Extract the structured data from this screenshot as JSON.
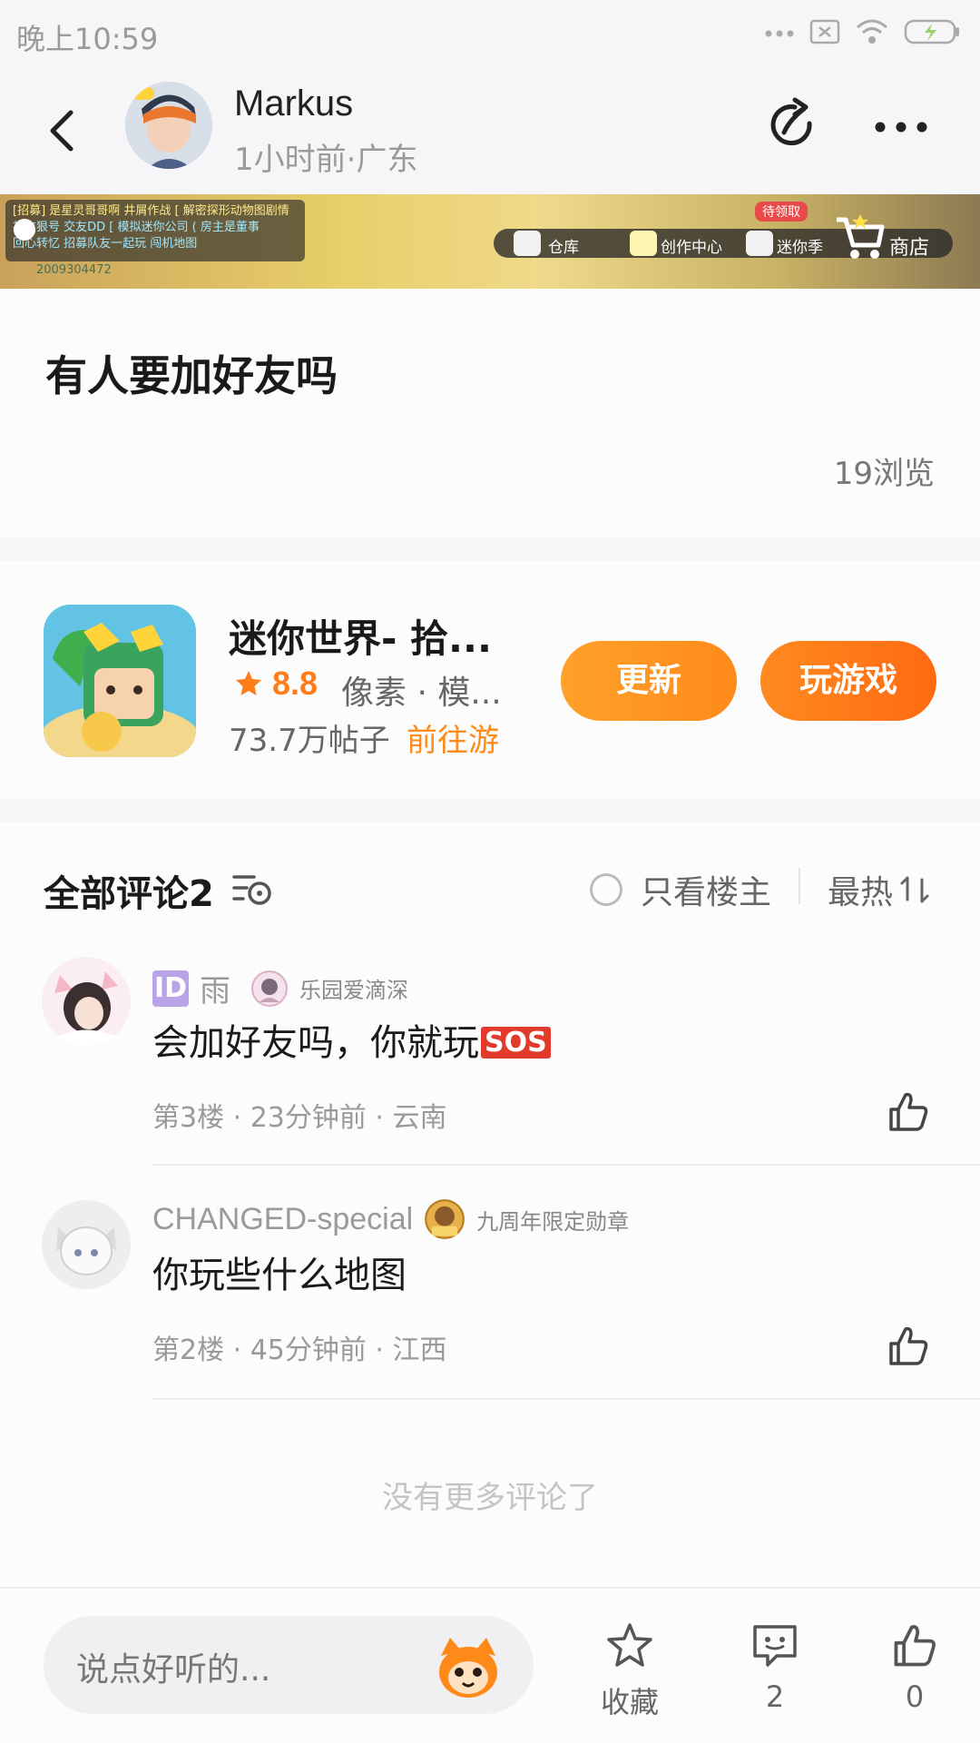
{
  "status": {
    "time": "晚上10:59"
  },
  "header": {
    "author": "Markus",
    "meta": "1小时前·广东"
  },
  "banner": {
    "chat_line1": "[招募] 是星灵哥哥啊  井屑作战 [  解密探形动物图剧情",
    "chat_line2": "  补衣狠号 交友DD [  模拟迷你公司 ( 房主是董事",
    "chat_line3": "  回心转忆 招募队友一起玩 闯机地图",
    "player_id": "2009304472",
    "toolbar": [
      "仓库",
      "创作中心",
      "迷你季",
      "商店"
    ],
    "pending": "待领取"
  },
  "post": {
    "title": "有人要加好友吗",
    "views": "19浏览"
  },
  "game": {
    "name": "迷你世界- 拾...",
    "rating": "8.8",
    "tags": "像素 · 模...",
    "posts": "73.7万帖子",
    "goto": "前往游",
    "update_label": "更新",
    "play_label": "玩游戏",
    "accent": "#ff8a1a"
  },
  "comments": {
    "title": "全部评论2",
    "only_owner": "只看楼主",
    "sort": "最热",
    "items": [
      {
        "name": "雨",
        "badge": "乐园爱滴深",
        "text": "会加好友吗，你就玩",
        "emoji": "SOS",
        "meta": "第3楼 · 23分钟前 · 云南"
      },
      {
        "name": "CHANGED-special",
        "badge": "九周年限定勋章",
        "text": "你玩些什么地图",
        "meta": "第2楼 · 45分钟前 · 江西"
      }
    ],
    "no_more": "没有更多评论了"
  },
  "bottom": {
    "placeholder": "说点好听的...",
    "favorite": "收藏",
    "comment_count": "2",
    "like_count": "0"
  }
}
